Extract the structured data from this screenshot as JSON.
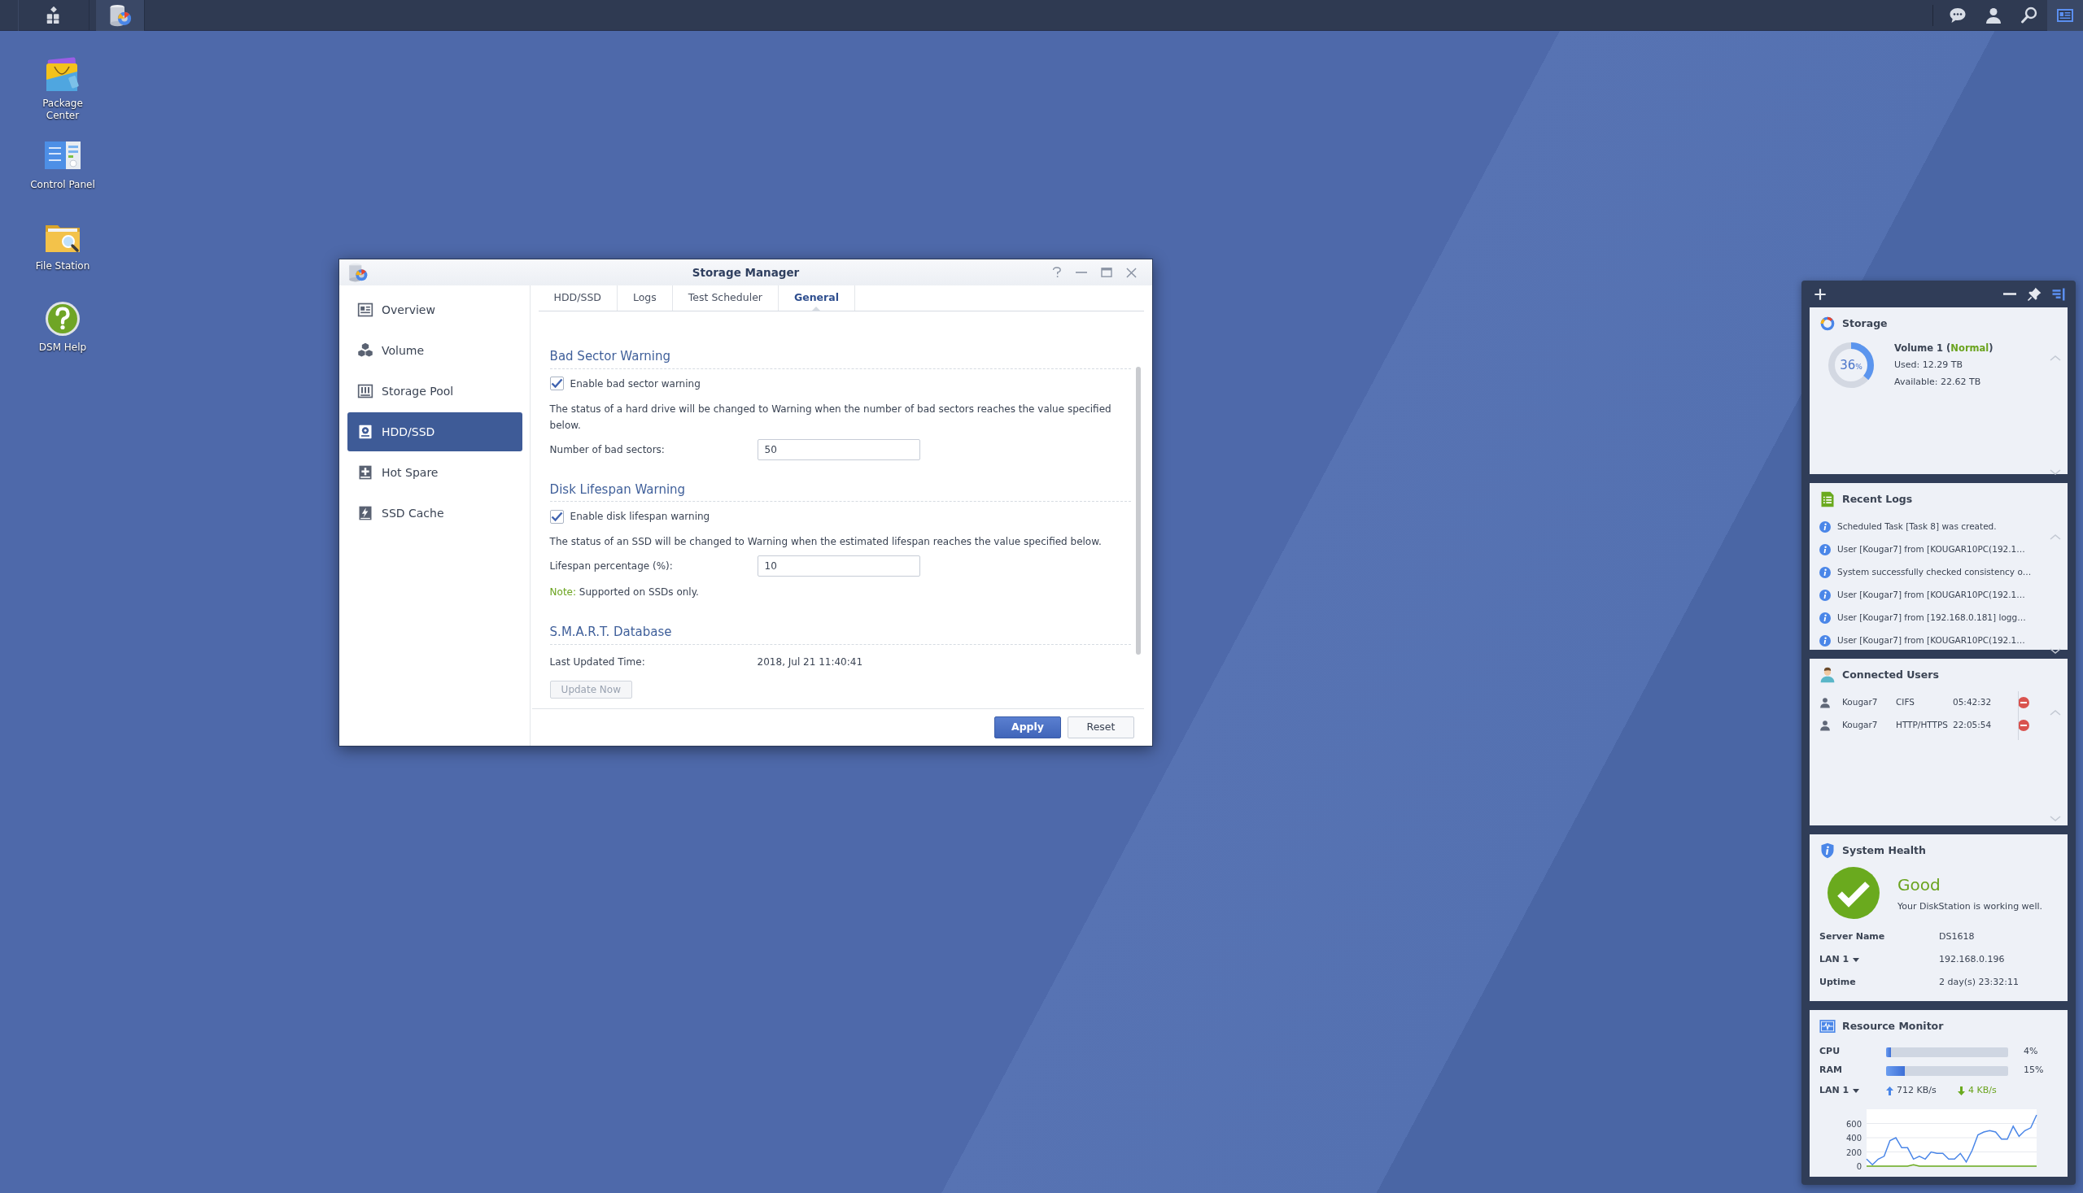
{
  "taskbar": {
    "apps": [
      {
        "kind": "main-menu",
        "selected": false
      },
      {
        "kind": "storage-manager",
        "selected": true
      }
    ],
    "tray": [
      {
        "kind": "chat",
        "selected": false
      },
      {
        "kind": "user",
        "selected": false
      },
      {
        "kind": "search",
        "selected": false
      },
      {
        "kind": "widgets",
        "selected": true
      }
    ]
  },
  "desktop_icons": [
    {
      "kind": "package-center",
      "label": "Package Center"
    },
    {
      "kind": "control-panel",
      "label": "Control Panel"
    },
    {
      "kind": "file-station",
      "label": "File Station"
    },
    {
      "kind": "help",
      "label": "DSM Help"
    }
  ],
  "window": {
    "title": "Storage Manager",
    "controls": [
      {
        "kind": "help"
      },
      {
        "kind": "minimize"
      },
      {
        "kind": "maximize"
      },
      {
        "kind": "close"
      }
    ],
    "sidebar": {
      "items": [
        {
          "kind": "overview",
          "label": "Overview",
          "selected": false
        },
        {
          "kind": "volume",
          "label": "Volume",
          "selected": false
        },
        {
          "kind": "storage-pool",
          "label": "Storage Pool",
          "selected": false
        },
        {
          "kind": "hdd",
          "label": "HDD/SSD",
          "selected": true
        },
        {
          "kind": "hot-spare",
          "label": "Hot Spare",
          "selected": false
        },
        {
          "kind": "ssd-cache",
          "label": "SSD Cache",
          "selected": false
        }
      ]
    },
    "tabs": [
      {
        "label": "HDD/SSD",
        "selected": false
      },
      {
        "label": "Logs",
        "selected": false
      },
      {
        "label": "Test Scheduler",
        "selected": false
      },
      {
        "label": "General",
        "selected": true
      }
    ],
    "sections": [
      {
        "heading": "Bad Sector Warning",
        "checkbox": {
          "label": "Enable bad sector warning",
          "checked": true
        },
        "description": "The status of a hard drive will be changed to Warning when the number of bad sectors reaches the value specified below.",
        "field": {
          "label": "Number of bad sectors:",
          "value": "50"
        }
      },
      {
        "heading": "Disk Lifespan Warning",
        "checkbox": {
          "label": "Enable disk lifespan warning",
          "checked": true
        },
        "description": "The status of an SSD will be changed to Warning when the estimated lifespan reaches the value specified below.",
        "field": {
          "label": "Lifespan percentage (%):",
          "value": "10"
        },
        "note": {
          "label": "Note:",
          "text": "Supported on SSDs only."
        }
      },
      {
        "heading": "S.M.A.R.T. Database",
        "info": {
          "label": "Last Updated Time:",
          "value": "2018, Jul 21 11:40:41"
        },
        "button": {
          "label": "Update Now",
          "disabled": true
        }
      }
    ],
    "buttons": [
      {
        "label": "Apply",
        "kind": "primary"
      },
      {
        "label": "Reset",
        "kind": "secondary"
      }
    ]
  },
  "widget_panel": {
    "controls": [
      {
        "kind": "add",
        "selected": false
      },
      {
        "kind": "minimize",
        "selected": false
      },
      {
        "kind": "pin",
        "selected": false
      },
      {
        "kind": "layout",
        "selected": true
      }
    ],
    "widgets": [
      {
        "kind": "storage",
        "title": "Storage",
        "volume": {
          "label": "Volume 1 (",
          "status": "Normal",
          "status_end": ")",
          "percent": "36",
          "percent_unit": "%",
          "level": 0.36,
          "used": "Used: 12.29 TB",
          "available": "Available: 22.62 TB"
        }
      },
      {
        "kind": "logs",
        "title": "Recent Logs",
        "entries": [
          "Scheduled Task [Task 8] was created.",
          "User [Kougar7] from [KOUGAR10PC(192.1…",
          "System successfully checked consistency o…",
          "User [Kougar7] from [KOUGAR10PC(192.1…",
          "User [Kougar7] from [192.168.0.181] logg…",
          "User [Kougar7] from [KOUGAR10PC(192.1…"
        ]
      },
      {
        "kind": "users",
        "title": "Connected Users",
        "users": [
          {
            "name": "Kougar7",
            "protocol": "CIFS",
            "time": "05:42:32"
          },
          {
            "name": "Kougar7",
            "protocol": "HTTP/HTTPS",
            "time": "22:05:54"
          }
        ]
      },
      {
        "kind": "health",
        "title": "System Health",
        "status": "Good",
        "message": "Your DiskStation is working well.",
        "rows": [
          {
            "label": "Server Name",
            "value": "DS1618",
            "dropdown": false
          },
          {
            "label": "LAN 1",
            "value": "192.168.0.196",
            "dropdown": true
          },
          {
            "label": "Uptime",
            "value": "2 day(s) 23:32:11",
            "dropdown": false
          }
        ]
      },
      {
        "kind": "resources",
        "title": "Resource Monitor",
        "meters": [
          {
            "label": "CPU",
            "level": 0.04,
            "reading": "4%"
          },
          {
            "label": "RAM",
            "level": 0.15,
            "reading": "15%"
          }
        ],
        "network": {
          "label": "LAN 1",
          "dropdown": true,
          "upload": "712 KB/s",
          "download": "4 KB/s"
        },
        "chart_data": {
          "type": "line",
          "grid": true,
          "ylim": [
            0,
            800
          ],
          "yticks": [
            0,
            200,
            400,
            600
          ],
          "series": [
            {
              "color": "#4a86e8",
              "values": [
                100,
                20,
                100,
                140,
                360,
                400,
                260,
                260,
                100,
                140,
                100,
                200,
                180,
                180,
                100,
                100,
                180,
                60,
                220,
                440,
                480,
                500,
                480,
                380,
                380,
                560,
                420,
                500,
                540,
                720
              ]
            },
            {
              "color": "#6aaa1e",
              "values": [
                0,
                0,
                0,
                0,
                0,
                0,
                0,
                0,
                20,
                0,
                0,
                0,
                0,
                0,
                0,
                0,
                0,
                0,
                0,
                0,
                0,
                0,
                0,
                0,
                0,
                0,
                0,
                0,
                0,
                0
              ]
            }
          ]
        }
      }
    ]
  }
}
